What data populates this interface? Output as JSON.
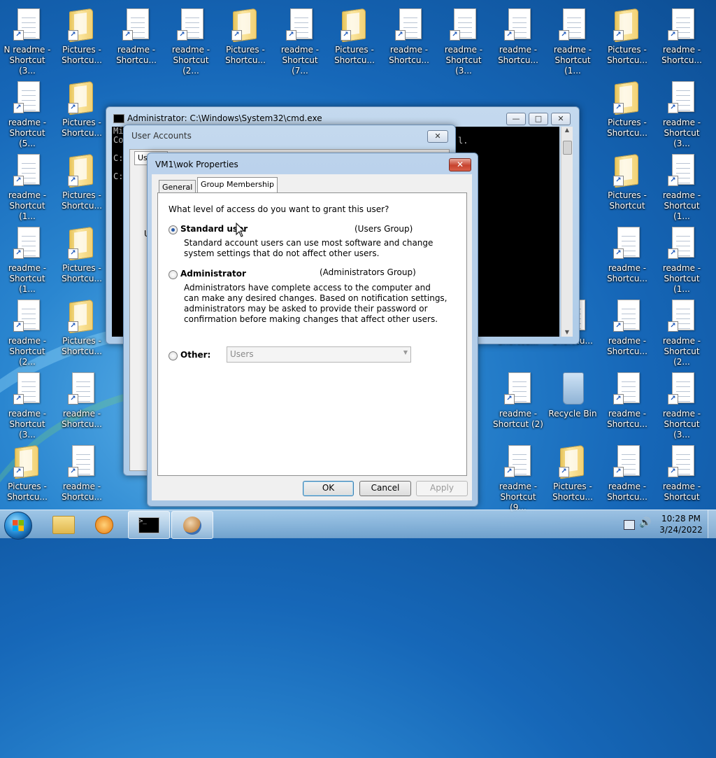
{
  "desktop": {
    "icons": [
      {
        "label": "N readme - Shortcut (3...",
        "type": "doc"
      },
      {
        "label": "Pictures - Shortcu...",
        "type": "folder"
      },
      {
        "label": "readme - Shortcu...",
        "type": "doc"
      },
      {
        "label": "readme - Shortcut (2...",
        "type": "doc"
      },
      {
        "label": "Pictures - Shortcu...",
        "type": "folder"
      },
      {
        "label": "readme - Shortcut (7...",
        "type": "doc"
      },
      {
        "label": "Pictures - Shortcu...",
        "type": "folder"
      },
      {
        "label": "readme - Shortcu...",
        "type": "doc"
      },
      {
        "label": "readme - Shortcut (3...",
        "type": "doc"
      },
      {
        "label": "readme - Shortcu...",
        "type": "doc"
      },
      {
        "label": "readme - Shortcut (1...",
        "type": "doc"
      },
      {
        "label": "Pictures - Shortcu...",
        "type": "folder"
      },
      {
        "label": "readme - Shortcu...",
        "type": "doc"
      },
      {
        "label": "readme - Shortcut (5...",
        "type": "doc"
      },
      {
        "label": "Pictures - Shortcu...",
        "type": "folder"
      },
      {
        "label": "readme - Shortcut (2...",
        "type": "doc"
      },
      {
        "label": "Pictures - Shortcu...",
        "type": "folder"
      },
      {
        "label": "readme - Shortcut (3...",
        "type": "doc"
      },
      {
        "label": "readme - Shortcut (1...",
        "type": "doc"
      },
      {
        "label": "Pictures - Shortcu...",
        "type": "folder"
      },
      {
        "label": "Pictures - Shortcut",
        "type": "folder"
      },
      {
        "label": "readme - Shortcut (1...",
        "type": "doc"
      },
      {
        "label": "readme - Shortcut (1...",
        "type": "doc"
      },
      {
        "label": "Pictures - Shortcu...",
        "type": "folder"
      },
      {
        "label": "readme - Shortcu...",
        "type": "doc"
      },
      {
        "label": "readme - Shortcut (1...",
        "type": "doc"
      },
      {
        "label": "readme - Shortcut (2...",
        "type": "doc"
      },
      {
        "label": "Pictures - Shortcu...",
        "type": "folder"
      },
      {
        "label": "Shortcu...",
        "type": "doc"
      },
      {
        "label": "Shortcu...",
        "type": "doc"
      },
      {
        "label": "readme - Shortcu...",
        "type": "doc"
      },
      {
        "label": "readme - Shortcut (2...",
        "type": "doc"
      },
      {
        "label": "readme - Shortcut (3...",
        "type": "doc"
      },
      {
        "label": "readme - Shortcu...",
        "type": "doc"
      },
      {
        "label": "readme - Shortcut (2)",
        "type": "doc"
      },
      {
        "label": "Recycle Bin",
        "type": "recycle"
      },
      {
        "label": "readme - Shortcu...",
        "type": "doc"
      },
      {
        "label": "readme - Shortcut (3...",
        "type": "doc"
      },
      {
        "label": "Pictures - Shortcu...",
        "type": "folder"
      },
      {
        "label": "readme - Shortcu...",
        "type": "doc"
      },
      {
        "label": "readme - Shortcut (9...",
        "type": "doc"
      },
      {
        "label": "Pictures - Shortcu...",
        "type": "folder"
      },
      {
        "label": "readme - Shortcu...",
        "type": "doc"
      },
      {
        "label": "readme - Shortcut",
        "type": "doc"
      }
    ]
  },
  "cmd_window": {
    "title": "Administrator: C:\\Windows\\System32\\cmd.exe",
    "lines": [
      "Mi",
      "Co",
      "",
      "C:",
      "",
      "C:"
    ],
    "right_text": "l.",
    "minimize": "—",
    "maximize": "□",
    "close": "✕"
  },
  "user_accounts": {
    "title": "User Accounts",
    "tab_partial": "Us",
    "label_partial": "U",
    "close": "✕"
  },
  "properties": {
    "title": "VM1\\wok Properties",
    "close": "✕",
    "tabs": [
      "General",
      "Group Membership"
    ],
    "prompt": "What level of access do you want to grant this user?",
    "standard": {
      "label": "Standard user",
      "group": "(Users Group)",
      "desc": [
        "Standard account users can use most software and change",
        "system settings that do not affect other users."
      ]
    },
    "admin": {
      "label": "Administrator",
      "group": "(Administrators Group)",
      "desc": [
        "Administrators have complete access to the computer and",
        "can make any desired changes. Based on notification settings,",
        "administrators may be asked to provide their password or",
        "confirmation before making changes that affect other users."
      ]
    },
    "other": {
      "label": "Other:",
      "value": "Users"
    },
    "buttons": {
      "ok": "OK",
      "cancel": "Cancel",
      "apply": "Apply"
    }
  },
  "taskbar": {
    "time": "10:28 PM",
    "date": "3/24/2022"
  }
}
